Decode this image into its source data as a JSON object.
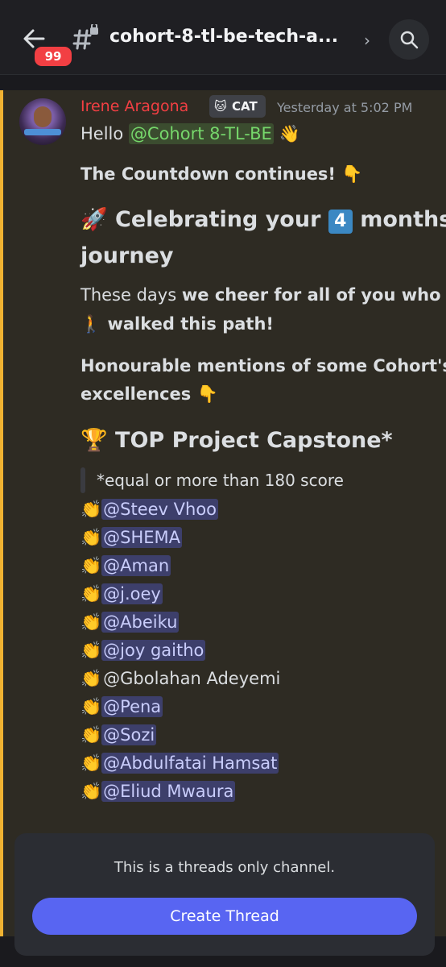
{
  "header": {
    "unread_count": "99",
    "channel_name": "cohort-8-tl-be-tech-a..."
  },
  "message": {
    "author": "Irene Aragona",
    "tag_label": "CAT",
    "timestamp": "Yesterday at 5:02 PM",
    "greeting": "Hello",
    "greeting_mention": "@Cohort 8-TL-BE",
    "greeting_emoji": "👋",
    "countdown": "The Countdown continues!",
    "pointing_emoji": "👇",
    "celebrating_emoji": "🚀",
    "celebrating_text_1": "Celebrating your",
    "celebrating_number": "4",
    "celebrating_text_2": "months",
    "celebrating_text_3": "journey",
    "cheer_text_1": "These days",
    "cheer_text_2": "we cheer for all of you who",
    "walking_emoji": "🚶",
    "cheer_text_3": "walked this path!",
    "mentions_text_1": "Honourable mentions of some Cohort's",
    "mentions_text_2": "excellences",
    "trophy_emoji": "🏆",
    "top_heading": "TOP Project Capstone*",
    "quote": "*equal or more than 180 score",
    "clap_emoji": "👏",
    "winners": [
      "@Steev Vhoo",
      "@SHEMA",
      "@Aman",
      "@j.oey",
      "@Abeiku",
      "@joy gaitho",
      "@Gbolahan Adeyemi",
      "@Pena",
      "@Sozi",
      "@Abdulfatai Hamsat",
      "@Eliud Mwaura"
    ]
  },
  "composer": {
    "info": "This is a threads only channel.",
    "button": "Create Thread"
  }
}
